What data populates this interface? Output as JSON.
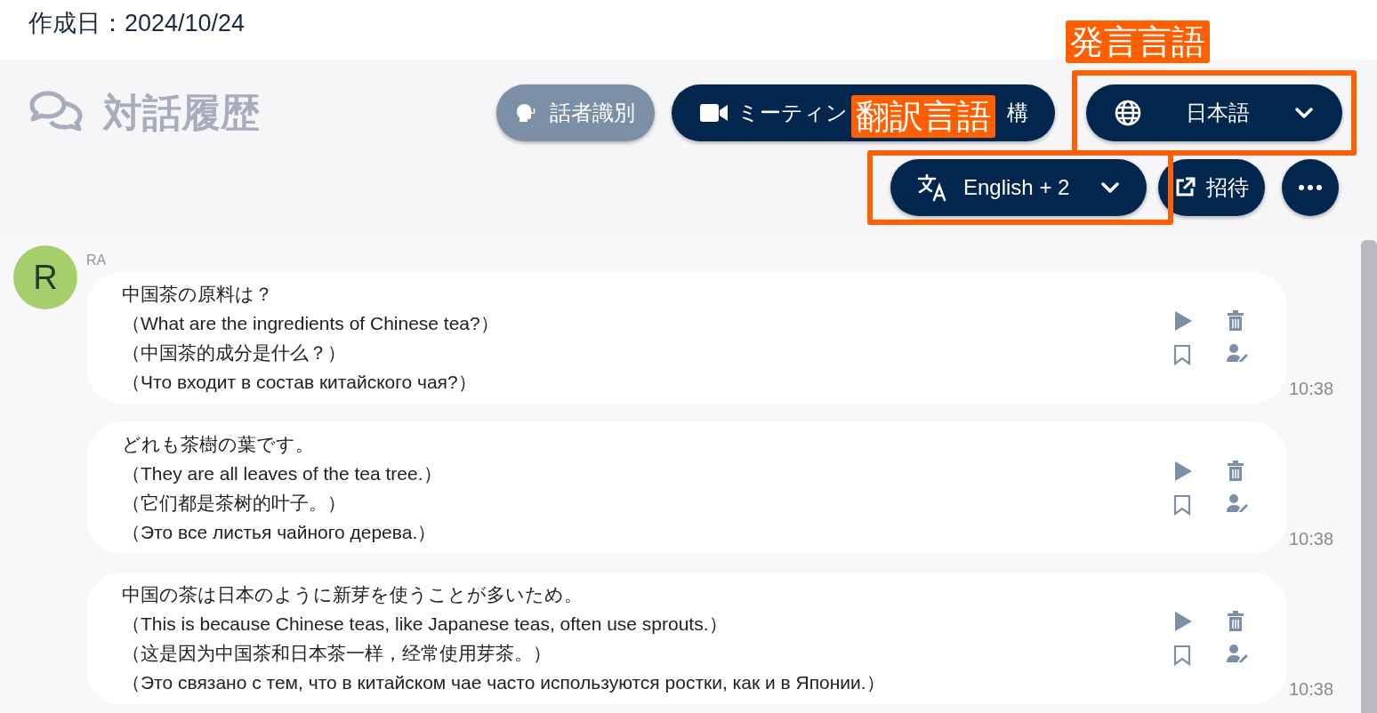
{
  "created": "作成日：2024/10/24",
  "title": "対話履歴",
  "toolbar": {
    "speaker_id": "話者識別",
    "meeting_start": "ミーティン",
    "meeting_end": "構",
    "speech_language": "日本語",
    "translation_language": "English + 2",
    "invite": "招待"
  },
  "annotations": {
    "speech": "発言言語",
    "translation": "翻訳言語"
  },
  "speaker": {
    "initial": "R",
    "name": "RA",
    "color": "#a5cf6b"
  },
  "messages": [
    {
      "lines": [
        "中国茶の原料は？",
        "（What are the ingredients of Chinese tea?）",
        "（中国茶的成分是什么？）",
        "（Что входит в состав китайского чая?）"
      ],
      "time": "10:38"
    },
    {
      "lines": [
        "どれも茶樹の葉です。",
        "（They are all leaves of the tea tree.）",
        "（它们都是茶树的叶子。）",
        "（Это все листья чайного дерева.）"
      ],
      "time": "10:38"
    },
    {
      "lines": [
        "中国の茶は日本のように新芽を使うことが多いため。",
        "（This is because Chinese teas, like Japanese teas, often use sprouts.）",
        "（这是因为中国茶和日本茶一样，经常使用芽茶。）",
        "（Это связано с тем, что в китайском чае часто используются ростки, как и в Японии.）"
      ],
      "time": "10:38"
    }
  ]
}
